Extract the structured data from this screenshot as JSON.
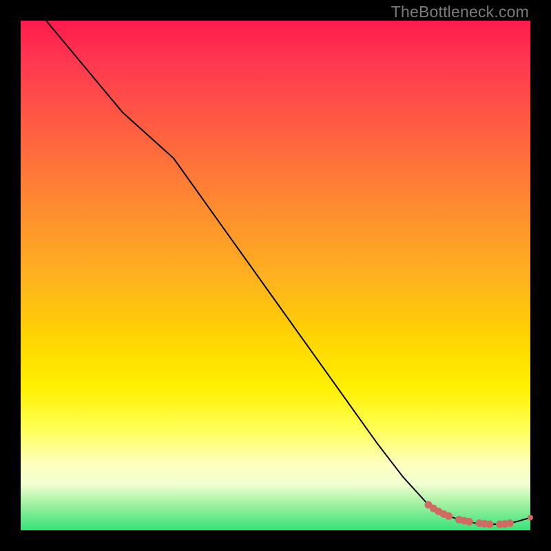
{
  "watermark": "TheBottleneck.com",
  "chart_data": {
    "type": "line",
    "title": "",
    "xlabel": "",
    "ylabel": "",
    "xlim": [
      0,
      100
    ],
    "ylim": [
      0,
      100
    ],
    "grid": false,
    "legend": false,
    "series": [
      {
        "name": "curve",
        "color": "#000000",
        "x": [
          5,
          10,
          15,
          20,
          25,
          30,
          35,
          40,
          45,
          50,
          55,
          60,
          65,
          70,
          75,
          80,
          82,
          84,
          86,
          88,
          90,
          92,
          94,
          96,
          98,
          100
        ],
        "y": [
          100,
          94,
          88,
          82,
          77.5,
          73,
          66,
          59,
          52,
          45,
          38,
          31,
          24,
          17,
          10.5,
          5,
          3.7,
          2.8,
          2.1,
          1.6,
          1.3,
          1.2,
          1.2,
          1.4,
          1.9,
          2.5
        ]
      }
    ],
    "highlight_points": {
      "name": "dots",
      "color": "#cf6b63",
      "radius_main": 5.5,
      "radius_end": 4,
      "points": [
        {
          "x": 80,
          "y": 5.0
        },
        {
          "x": 81,
          "y": 4.3
        },
        {
          "x": 82,
          "y": 3.7
        },
        {
          "x": 83,
          "y": 3.2
        },
        {
          "x": 84,
          "y": 2.8
        },
        {
          "x": 86,
          "y": 2.1
        },
        {
          "x": 87,
          "y": 1.9
        },
        {
          "x": 88,
          "y": 1.7
        },
        {
          "x": 90,
          "y": 1.4
        },
        {
          "x": 91,
          "y": 1.3
        },
        {
          "x": 92,
          "y": 1.2
        },
        {
          "x": 94,
          "y": 1.2
        },
        {
          "x": 95,
          "y": 1.25
        },
        {
          "x": 96,
          "y": 1.4
        },
        {
          "x": 100,
          "y": 2.5
        }
      ]
    },
    "background_gradient": {
      "top": "#ff1a4d",
      "mid_upper": "#ff8a30",
      "mid": "#fff000",
      "mid_lower": "#ffffc0",
      "bottom": "#35e27a"
    }
  }
}
